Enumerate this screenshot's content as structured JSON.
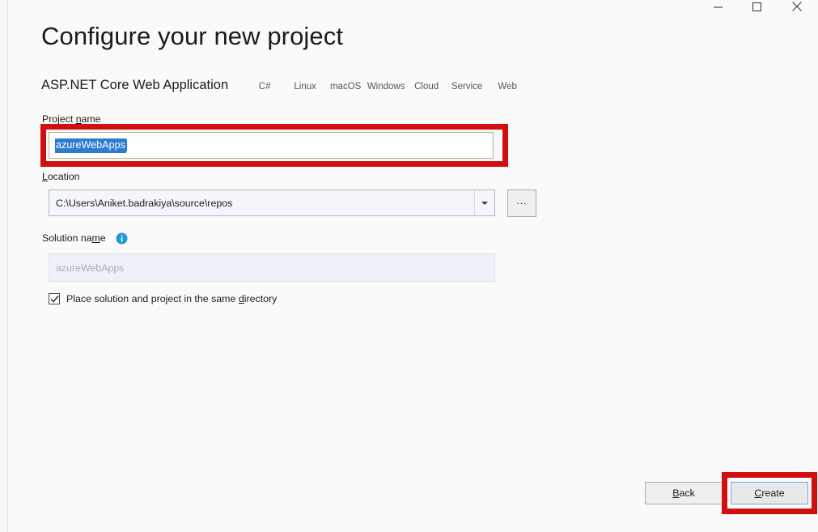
{
  "window": {
    "controls": [
      {
        "name": "minimize",
        "glyph": "minimize-icon"
      },
      {
        "name": "maximize",
        "glyph": "maximize-icon"
      },
      {
        "name": "close",
        "glyph": "close-icon"
      }
    ]
  },
  "header": {
    "title": "Configure your new project",
    "template_name": "ASP.NET Core Web Application",
    "tags": [
      "C#",
      "Linux",
      "macOS",
      "Windows",
      "Cloud",
      "Service",
      "Web"
    ]
  },
  "form": {
    "project_name": {
      "label_before": "Project ",
      "label_accel": "n",
      "label_after": "ame",
      "value": "azureWebApps",
      "selected": true,
      "focused": true
    },
    "location": {
      "label_accel": "L",
      "label_after": "ocation",
      "value": "C:\\Users\\Aniket.badrakiya\\source\\repos",
      "dropdown_icon": "chevron-down-icon",
      "browse_label": "...",
      "browse_icon": "ellipsis-icon"
    },
    "solution_name": {
      "label_before": "Solution na",
      "label_accel": "m",
      "label_after": "e",
      "value": "azureWebApps",
      "disabled": true,
      "info_icon": "info-icon"
    },
    "same_directory_checkbox": {
      "checked": true,
      "label_before": "Place solution and project in the same ",
      "label_accel": "d",
      "label_after": "irectory",
      "check_icon": "checkmark-icon"
    }
  },
  "footer": {
    "back_accel": "B",
    "back_after": "ack",
    "create_accel": "C",
    "create_after": "reate"
  },
  "annotations": {
    "color": "#d10f0f",
    "targets": [
      "project-name-field",
      "create-button"
    ]
  },
  "colors": {
    "page_background": "#fafafa",
    "selection_blue": "#2c7dd0",
    "info_blue": "#1f9ad6",
    "focus_border": "#7aa8c9",
    "annotation_red": "#d10f0f",
    "disabled_field": "#eef1f8",
    "disabled_text": "#a9adb7"
  }
}
